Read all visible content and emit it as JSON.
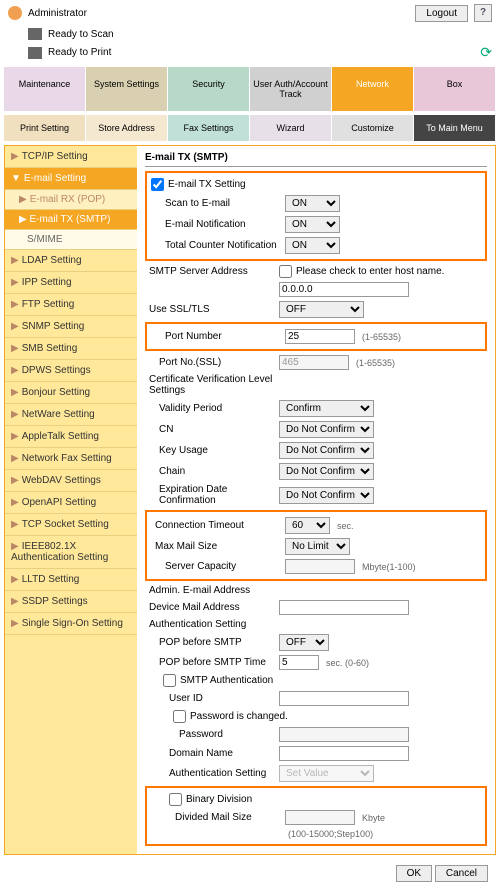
{
  "header": {
    "admin": "Administrator",
    "logout": "Logout",
    "scan": "Ready to Scan",
    "print": "Ready to Print"
  },
  "tabs1": {
    "maint": "Maintenance",
    "sys": "System Settings",
    "sec": "Security",
    "user": "User Auth/Account Track",
    "net": "Network",
    "box": "Box"
  },
  "tabs2": {
    "print": "Print Setting",
    "store": "Store Address",
    "fax": "Fax Settings",
    "wiz": "Wizard",
    "cust": "Customize",
    "main": "To Main Menu"
  },
  "side": {
    "tcpip": "TCP/IP Setting",
    "email": "E-mail Setting",
    "rx": "E-mail RX (POP)",
    "tx": "E-mail TX (SMTP)",
    "smime": "S/MIME",
    "ldap": "LDAP Setting",
    "ipp": "IPP Setting",
    "ftp": "FTP Setting",
    "snmp": "SNMP Setting",
    "smb": "SMB Setting",
    "dpws": "DPWS Settings",
    "bonjour": "Bonjour Setting",
    "netware": "NetWare Setting",
    "apple": "AppleTalk Setting",
    "netfax": "Network Fax Setting",
    "webdav": "WebDAV Settings",
    "openapi": "OpenAPI Setting",
    "tcpsock": "TCP Socket Setting",
    "ieee": "IEEE802.1X Authentication Setting",
    "lltd": "LLTD Setting",
    "ssdp": "SSDP Settings",
    "sso": "Single Sign-On Setting"
  },
  "main": {
    "title": "E-mail TX (SMTP)",
    "txsetting": "E-mail TX Setting",
    "scan": "Scan to E-mail",
    "notif": "E-mail Notification",
    "counter": "Total Counter Notification",
    "on": "ON",
    "smtpaddr": "SMTP Server Address",
    "hostcheck": "Please check to enter host name.",
    "ip": "0.0.0.0",
    "ssl": "Use SSL/TLS",
    "off": "OFF",
    "port": "Port Number",
    "portv": "25",
    "portssl": "Port No.(SSL)",
    "portsslv": "465",
    "range": "(1-65535)",
    "cert": "Certificate Verification Level Settings",
    "validity": "Validity Period",
    "confirm": "Confirm",
    "cn": "CN",
    "keyusage": "Key Usage",
    "chain": "Chain",
    "expire": "Expiration Date Confirmation",
    "donot": "Do Not Confirm",
    "timeout": "Connection Timeout",
    "timeoutv": "60",
    "sec": "sec.",
    "maxmail": "Max Mail Size",
    "nolimit": "No Limit",
    "servercap": "Server Capacity",
    "mbyte": "Mbyte(1-100)",
    "adminaddr": "Admin. E-mail Address",
    "devaddr": "Device Mail Address",
    "auth": "Authentication Setting",
    "popsmtp": "POP before SMTP",
    "popsmtpv": "OFF",
    "poptime": "POP before SMTP Time",
    "poptimev": "5",
    "sec060": "sec. (0-60)",
    "smtpauth": "SMTP Authentication",
    "userid": "User ID",
    "pwdchg": "Password is changed.",
    "pwd": "Password",
    "domain": "Domain Name",
    "authset": "Authentication Setting",
    "setval": "Set Value",
    "binary": "Binary Division",
    "divsize": "Divided Mail Size",
    "kbyte": "Kbyte",
    "kbrange": "(100-15000;Step100)",
    "ok": "OK",
    "cancel": "Cancel"
  }
}
